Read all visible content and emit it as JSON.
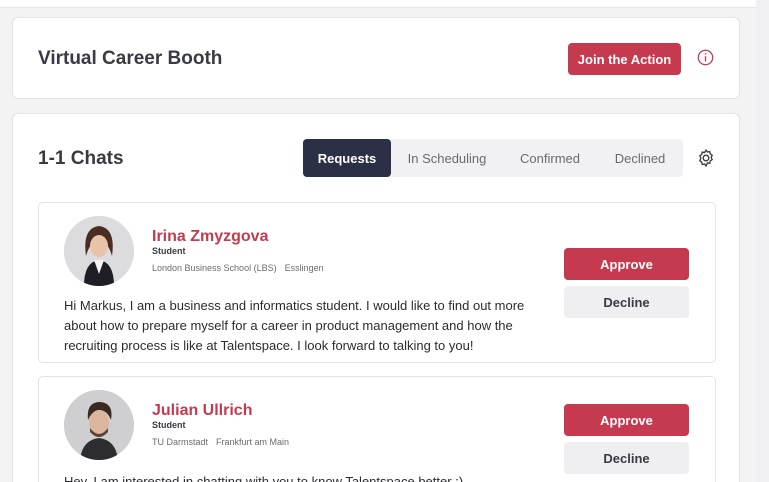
{
  "booth": {
    "title": "Virtual Career Booth",
    "join_label": "Join the Action",
    "info_icon": "info-icon"
  },
  "chats": {
    "title": "1-1 Chats",
    "tabs": [
      {
        "label": "Requests",
        "active": true
      },
      {
        "label": "In Scheduling",
        "active": false
      },
      {
        "label": "Confirmed",
        "active": false
      },
      {
        "label": "Declined",
        "active": false
      }
    ],
    "settings_icon": "gear-icon",
    "requests": [
      {
        "name": "Irina Zmyzgova",
        "role": "Student",
        "school": "London Business School (LBS)",
        "location": "Esslingen",
        "message": "Hi Markus, I am a business and informatics student. I would like to find out more about how to prepare myself for a career in product management and how the recruiting process is like at Talentspace. I look forward to talking to you!",
        "approve_label": "Approve",
        "decline_label": "Decline"
      },
      {
        "name": "Julian Ullrich",
        "role": "Student",
        "school": "TU Darmstadt",
        "location": "Frankfurt am Main",
        "message": "Hey, I am interested in chatting with you to know Talentspace better :)",
        "approve_label": "Approve",
        "decline_label": "Decline"
      }
    ]
  },
  "colors": {
    "accent": "#c63a4f",
    "active_tab": "#2c3047"
  }
}
